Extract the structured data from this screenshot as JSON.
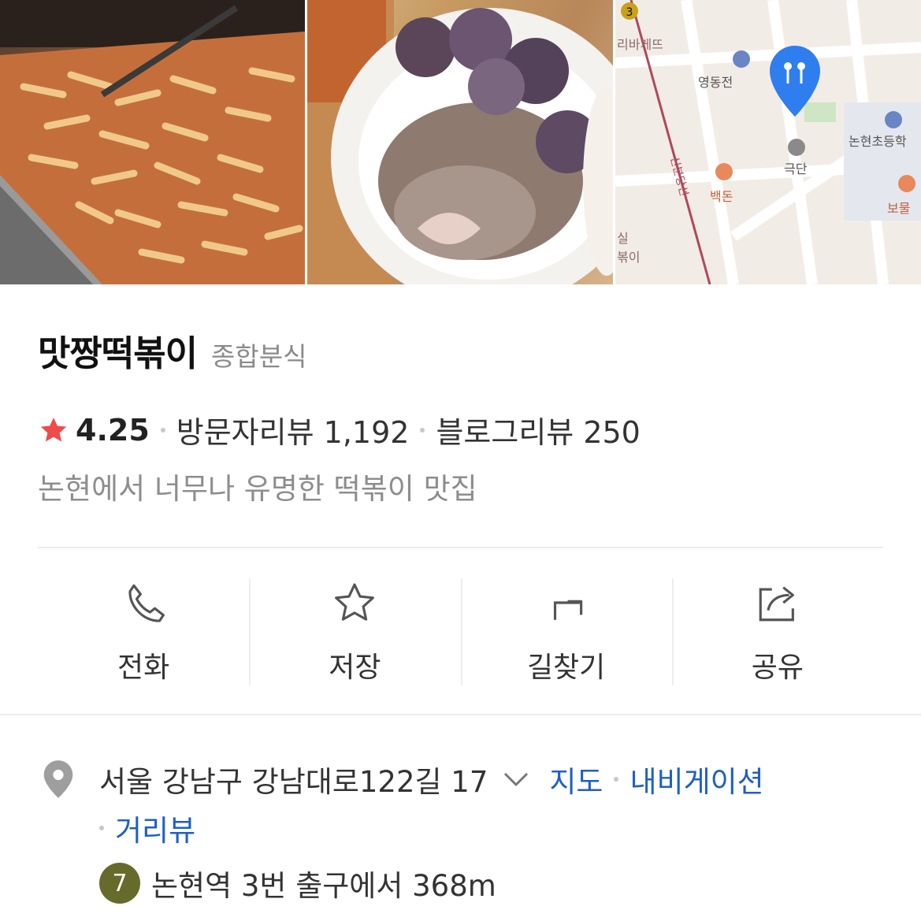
{
  "photos": [
    {
      "name": "tteokbokki-photo"
    },
    {
      "name": "sundae-photo"
    },
    {
      "name": "map-thumbnail",
      "map_labels": [
        "리바게뜨",
        "영동전",
        "논현초등학",
        "극단",
        "백돈",
        "보물",
        "신분당선",
        "실",
        "볶이"
      ],
      "station_badge": "3"
    }
  ],
  "place": {
    "name": "맛짱떡볶이",
    "category": "종합분식",
    "rating": "4.25",
    "visitor_reviews": "방문자리뷰 1,192",
    "blog_reviews": "블로그리뷰 250",
    "description": "논현에서 너무나 유명한 떡볶이 맛집"
  },
  "actions": [
    {
      "label": "전화",
      "icon": "phone-icon"
    },
    {
      "label": "저장",
      "icon": "star-outline-icon"
    },
    {
      "label": "길찾기",
      "icon": "directions-icon"
    },
    {
      "label": "공유",
      "icon": "share-icon"
    }
  ],
  "address": {
    "text": "서울 강남구 강남대로122길 17",
    "links": {
      "map": "지도",
      "navigation": "내비게이션",
      "street_view": "거리뷰"
    }
  },
  "transit": {
    "line": "7",
    "line_color": "#666b2b",
    "text": "논현역 3번 출구에서 368m"
  },
  "colors": {
    "accent_link": "#1f5fc8",
    "star": "#f04b4b",
    "pin": "#9e9e9e"
  }
}
